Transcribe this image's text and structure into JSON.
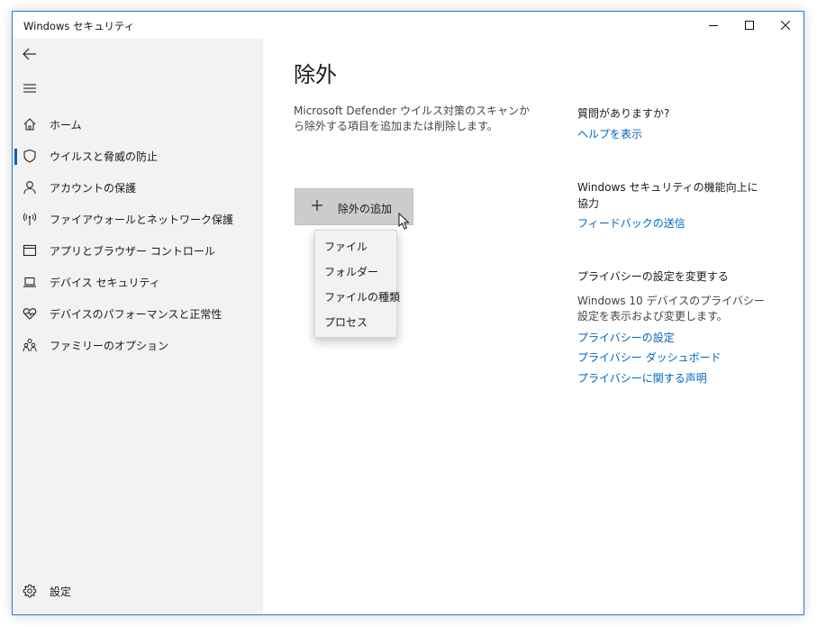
{
  "window": {
    "title": "Windows セキュリティ",
    "accent": "#0063b1",
    "link_color": "#0067c0",
    "controls": [
      "minimize-icon",
      "maximize-icon",
      "close-icon"
    ]
  },
  "sidebar": {
    "back_icon": "back-arrow-icon",
    "menu_icon": "hamburger-icon",
    "items": [
      {
        "label": "ホーム",
        "icon": "home-icon"
      },
      {
        "label": "ウイルスと脅威の防止",
        "icon": "shield-icon",
        "selected": true
      },
      {
        "label": "アカウントの保護",
        "icon": "person-icon"
      },
      {
        "label": "ファイアウォールとネットワーク保護",
        "icon": "wireless-icon"
      },
      {
        "label": "アプリとブラウザー コントロール",
        "icon": "app-window-icon"
      },
      {
        "label": "デバイス セキュリティ",
        "icon": "laptop-icon"
      },
      {
        "label": "デバイスのパフォーマンスと正常性",
        "icon": "heart-pulse-icon"
      },
      {
        "label": "ファミリーのオプション",
        "icon": "family-icon"
      }
    ],
    "settings": {
      "label": "設定",
      "icon": "gear-icon"
    }
  },
  "main": {
    "title": "除外",
    "description": "Microsoft Defender ウイルス対策のスキャンから除外する項目を追加または削除します。",
    "add_button": {
      "label": "除外の追加",
      "icon": "plus-icon"
    },
    "dropdown": [
      "ファイル",
      "フォルダー",
      "ファイルの種類",
      "プロセス"
    ]
  },
  "right": {
    "help": {
      "heading": "質問がありますか?",
      "link": "ヘルプを表示"
    },
    "feedback": {
      "heading": "Windows セキュリティの機能向上に協力",
      "link": "フィードバックの送信"
    },
    "privacy": {
      "heading": "プライバシーの設定を変更する",
      "text": "Windows 10 デバイスのプライバシー設定を表示および変更します。",
      "links": [
        "プライバシーの設定",
        "プライバシー ダッシュボード",
        "プライバシーに関する声明"
      ]
    }
  }
}
